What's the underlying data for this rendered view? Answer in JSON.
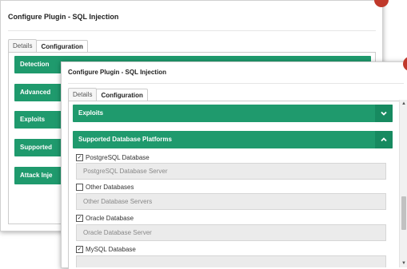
{
  "back_dialog": {
    "title": "Configure Plugin - SQL Injection",
    "tabs": [
      "Details",
      "Configuration"
    ],
    "sections": [
      "Detection",
      "Advanced",
      "Exploits",
      "Supported",
      "Attack Inje"
    ]
  },
  "front_dialog": {
    "title": "Configure Plugin - SQL Injection",
    "tabs": [
      "Details",
      "Configuration"
    ],
    "sections": {
      "exploits": "Exploits",
      "supported_platforms": "Supported Database Platforms"
    },
    "platforms": [
      {
        "label": "PostgreSQL Database",
        "checked": true,
        "value": "PostgreSQL Database Server"
      },
      {
        "label": "Other Databases",
        "checked": false,
        "value": "Other Database Servers"
      },
      {
        "label": "Oracle Database",
        "checked": true,
        "value": "Oracle Database Server"
      },
      {
        "label": "MySQL Database",
        "checked": true,
        "value": ""
      }
    ]
  },
  "colors": {
    "accent": "#1f9a6d",
    "accent_dark": "#178a60",
    "close": "#c0392b"
  },
  "icons": {
    "collapsed": "chevron-down-icon",
    "expanded": "chevron-up-icon",
    "checked": "checkmark-icon"
  }
}
